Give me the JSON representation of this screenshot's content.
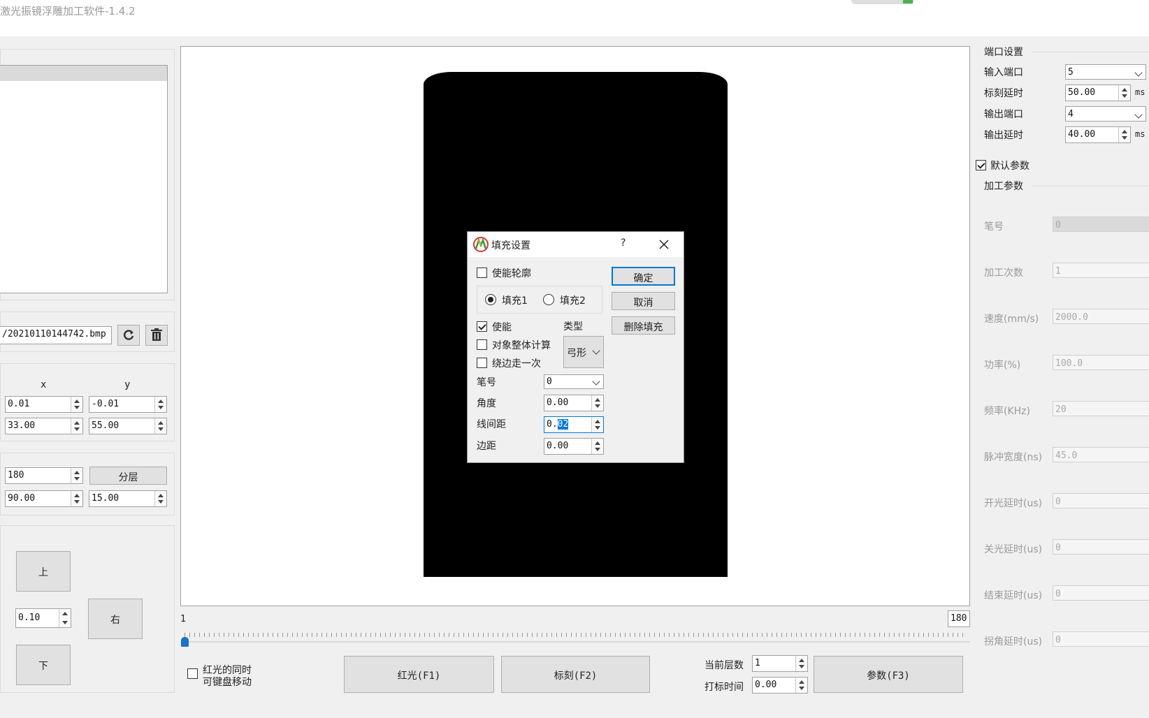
{
  "window": {
    "title": "激光振镜浮雕加工软件-1.4.2"
  },
  "left": {
    "file_path": "/20210110144742.bmp",
    "coord_header": {
      "x": "x",
      "y": "y"
    },
    "pos_x": "0.01",
    "pos_y": "-0.01",
    "size_x": "33.00",
    "size_y": "55.00",
    "layers": "180",
    "layer_button": "分层",
    "val_a": "90.00",
    "val_b": "15.00",
    "up": "上",
    "right": "右",
    "down": "下",
    "step": "0.10"
  },
  "canvas": {
    "slider_min": "1",
    "slider_max": "180"
  },
  "bottom": {
    "redlight_move_line1": "红光的同时",
    "redlight_move_line2": "可键盘移动",
    "redlight_button": "红光(F1)",
    "mark_button": "标刻(F2)",
    "current_layer_label": "当前层数",
    "current_layer": "1",
    "mark_time_label": "打标时间",
    "mark_time": "0.00",
    "params_button": "参数(F3)"
  },
  "right": {
    "port_section": "端口设置",
    "input_port_label": "输入端口",
    "input_port": "5",
    "mark_delay_label": "标刻延时",
    "mark_delay": "50.00",
    "ms": "ms",
    "output_port_label": "输出端口",
    "output_port": "4",
    "output_delay_label": "输出延时",
    "output_delay": "40.00",
    "default_params": "默认参数",
    "process_section": "加工参数",
    "params": [
      {
        "label": "笔号",
        "value": "0"
      },
      {
        "label": "加工次数",
        "value": "1"
      },
      {
        "label": "速度(mm/s)",
        "value": "2000.0"
      },
      {
        "label": "功率(%)",
        "value": "100.0"
      },
      {
        "label": "频率(KHz)",
        "value": "20"
      },
      {
        "label": "脉冲宽度(ns)",
        "value": "45.0"
      },
      {
        "label": "开光延时(us)",
        "value": "0"
      },
      {
        "label": "关光延时(us)",
        "value": "0"
      },
      {
        "label": "结束延时(us)",
        "value": "0"
      },
      {
        "label": "拐角延时(us)",
        "value": "0"
      }
    ]
  },
  "dialog": {
    "title": "填充设置",
    "help": "?",
    "enable_outline": "使能轮廓",
    "fill1": "填充1",
    "fill2": "填充2",
    "enable": "使能",
    "type_label": "类型",
    "type_value": "弓形",
    "whole_calc": "对象整体计算",
    "edge_once": "绕边走一次",
    "pen_label": "笔号",
    "pen_value": "0",
    "angle_label": "角度",
    "angle_value": "0.00",
    "spacing_label": "线间距",
    "spacing_prefix": "0.",
    "spacing_selected": "02",
    "margin_label": "边距",
    "margin_value": "0.00",
    "ok": "确定",
    "cancel": "取消",
    "delete_fill": "删除填充"
  }
}
